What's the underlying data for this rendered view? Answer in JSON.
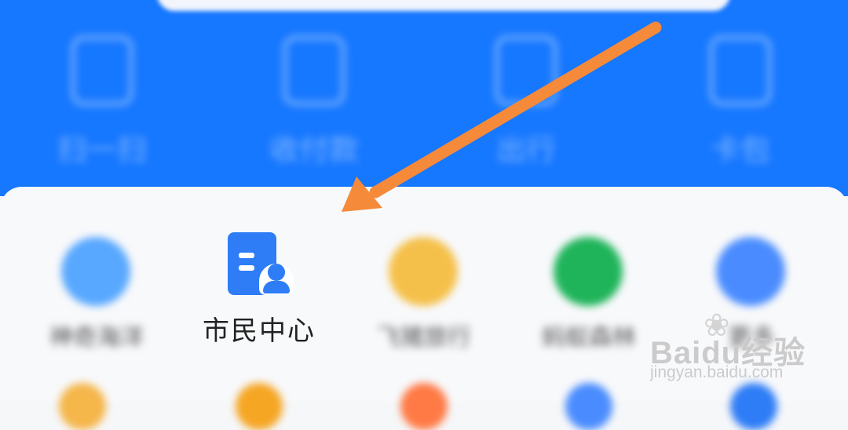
{
  "top_tools": [
    {
      "label": "扫一扫",
      "icon": "scan-icon"
    },
    {
      "label": "收付款",
      "icon": "pay-receive-icon"
    },
    {
      "label": "出行",
      "icon": "travel-icon"
    },
    {
      "label": "卡包",
      "icon": "card-pack-icon"
    }
  ],
  "apps": [
    {
      "label": "神奇海洋",
      "icon": "magic-ocean-icon",
      "color": "#58a8ff"
    },
    {
      "label": "市民中心",
      "icon": "citizen-center-icon",
      "color": "#2e7df6"
    },
    {
      "label": "飞猪旅行",
      "icon": "fliggy-icon",
      "color": "#f5c04a"
    },
    {
      "label": "蚂蚁森林",
      "icon": "ant-forest-icon",
      "color": "#1fb45a"
    },
    {
      "label": "更多",
      "icon": "more-icon",
      "color": "#4a8cff"
    }
  ],
  "watermark": {
    "brand": "Baidu经验",
    "url": "jingyan.baidu.com"
  },
  "colors": {
    "header_blue": "#1677ff",
    "arrow_orange": "#f58a3a"
  }
}
